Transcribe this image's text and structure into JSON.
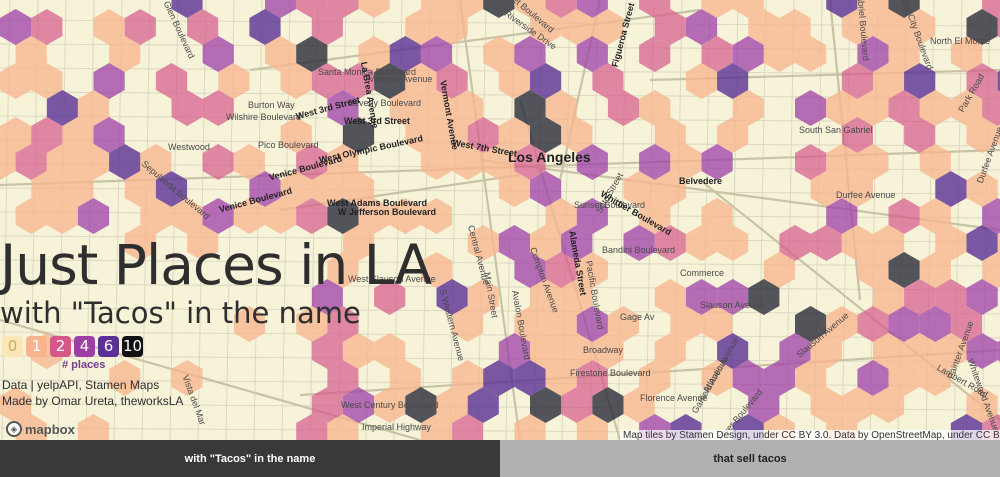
{
  "map": {
    "city_label": "Los Angeles",
    "hex_colors": [
      "#f8b48c",
      "#d6588a",
      "#9e3fa8",
      "#5b2f95",
      "#2a2a3a"
    ],
    "streets": [
      {
        "text": "Sunset Boulevard"
      },
      {
        "text": "Beverly Glen Boulevard"
      },
      {
        "text": "Santa Monica Boulevard"
      },
      {
        "text": "Melrose Avenue"
      },
      {
        "text": "Burton Way"
      },
      {
        "text": "La Brea Avenue"
      },
      {
        "text": "Beverly Boulevard"
      },
      {
        "text": "Wilshire Boulevard"
      },
      {
        "text": "West 3rd Street"
      },
      {
        "text": "West 3rd Street"
      },
      {
        "text": "Vermont Avenue"
      },
      {
        "text": "West 7th Street"
      },
      {
        "text": "Westwood"
      },
      {
        "text": "Pico Boulevard"
      },
      {
        "text": "West Olympic Boulevard"
      },
      {
        "text": "Venice Boulevard"
      },
      {
        "text": "Sepulveda Boulevard"
      },
      {
        "text": "Venice Boulevard"
      },
      {
        "text": "West Adams Boulevard"
      },
      {
        "text": "W Jefferson Boulevard"
      },
      {
        "text": "Riverside Drive"
      },
      {
        "text": "Figueroa Street"
      },
      {
        "text": "Sunset Boulevard"
      },
      {
        "text": "Soto Street"
      },
      {
        "text": "Belvedere"
      },
      {
        "text": "Whittier Boulevard"
      },
      {
        "text": "Bandini Boulevard"
      },
      {
        "text": "Commerce"
      },
      {
        "text": "Slauson Avenue"
      },
      {
        "text": "West Slauson Avenue"
      },
      {
        "text": "Gage Av"
      },
      {
        "text": "Broadway"
      },
      {
        "text": "Firestone Boulevard"
      },
      {
        "text": "Florence Avenue"
      },
      {
        "text": "West Century Boulevard"
      },
      {
        "text": "Imperial Highway"
      },
      {
        "text": "South San Gabriel"
      },
      {
        "text": "Durfee Avenue"
      },
      {
        "text": "Gabriel Boulevard"
      },
      {
        "text": "Temple City Boulevard"
      },
      {
        "text": "North El Monte"
      },
      {
        "text": "Park Road"
      },
      {
        "text": "Durfee Avenue"
      },
      {
        "text": "Slauson Avenue"
      },
      {
        "text": "Painter Avenue"
      },
      {
        "text": "Lambert Road"
      },
      {
        "text": "Whitewood Avenue"
      },
      {
        "text": "Alameda Street"
      },
      {
        "text": "Compton Avenue"
      },
      {
        "text": "Avalon Boulevard"
      },
      {
        "text": "Pacific Boulevard"
      },
      {
        "text": "Atlantic Avenue"
      },
      {
        "text": "Garfield Avenue"
      },
      {
        "text": "River Boulevard"
      },
      {
        "text": "Vista del Mar"
      },
      {
        "text": "S Western Avenue"
      },
      {
        "text": "Main Street"
      },
      {
        "text": "Central Avenue"
      }
    ]
  },
  "overlay": {
    "title": "Just Places in LA",
    "subtitle": "with \"Tacos\" in the name",
    "legend": [
      {
        "label": "0",
        "bg": "#fbe7b5",
        "fg": "#c9a86a"
      },
      {
        "label": "1",
        "bg": "#f8b48c",
        "fg": "#ffffff"
      },
      {
        "label": "2",
        "bg": "#d6588a",
        "fg": "#ffffff"
      },
      {
        "label": "4",
        "bg": "#9e3fa8",
        "fg": "#ffffff"
      },
      {
        "label": "6",
        "bg": "#5b2f95",
        "fg": "#ffffff"
      },
      {
        "label": "10",
        "bg": "#111111",
        "fg": "#ffffff"
      }
    ],
    "legend_caption": "# places",
    "credits_line1": "Data | yelpAPI, Stamen Maps",
    "credits_line2": "Made by Omar Ureta, theworksLA"
  },
  "mapbox_logo": "mapbox",
  "attribution": "Map tiles by Stamen Design, under CC BY 3.0. Data by OpenStreetMap, under CC BY S",
  "tabs": [
    {
      "label": "with \"Tacos\" in the name",
      "active": true
    },
    {
      "label": "that sell tacos",
      "active": false
    }
  ]
}
